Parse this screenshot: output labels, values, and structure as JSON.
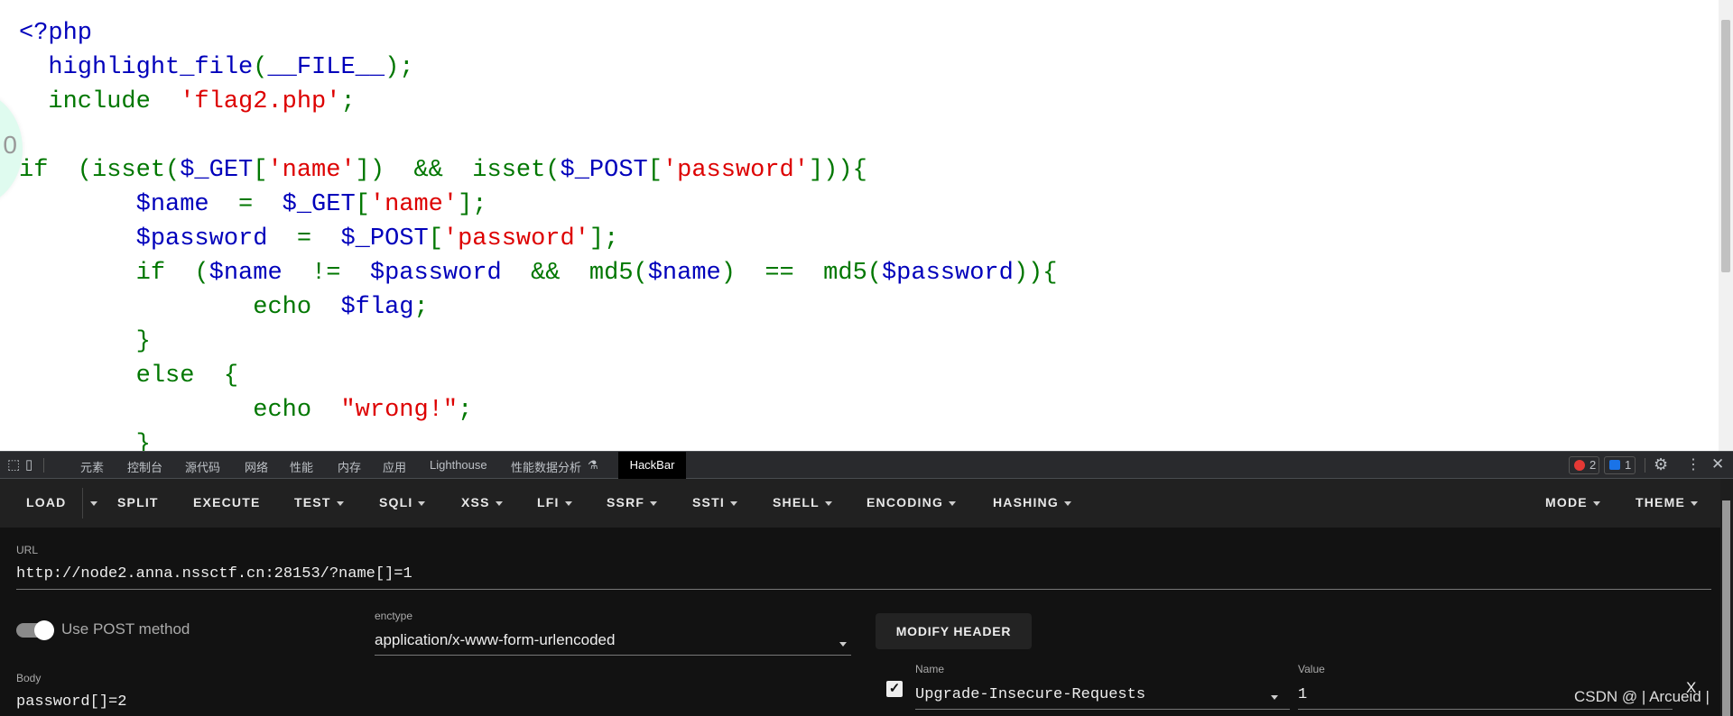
{
  "code": {
    "lines": [
      [
        {
          "t": "<?php",
          "c": "b"
        }
      ],
      [
        {
          "t": "  highlight_file",
          "c": "b"
        },
        {
          "t": "(",
          "c": "g"
        },
        {
          "t": "__FILE__",
          "c": "b"
        },
        {
          "t": ");",
          "c": "g"
        }
      ],
      [
        {
          "t": "  include  ",
          "c": "g"
        },
        {
          "t": "'flag2.php'",
          "c": "r"
        },
        {
          "t": ";",
          "c": "g"
        }
      ],
      [],
      [
        {
          "t": "if  (isset(",
          "c": "g"
        },
        {
          "t": "$_GET",
          "c": "b"
        },
        {
          "t": "[",
          "c": "g"
        },
        {
          "t": "'name'",
          "c": "r"
        },
        {
          "t": "])  &&  isset(",
          "c": "g"
        },
        {
          "t": "$_POST",
          "c": "b"
        },
        {
          "t": "[",
          "c": "g"
        },
        {
          "t": "'password'",
          "c": "r"
        },
        {
          "t": "])){",
          "c": "g"
        }
      ],
      [
        {
          "t": "        $name",
          "c": "b"
        },
        {
          "t": "  =  ",
          "c": "g"
        },
        {
          "t": "$_GET",
          "c": "b"
        },
        {
          "t": "[",
          "c": "g"
        },
        {
          "t": "'name'",
          "c": "r"
        },
        {
          "t": "];",
          "c": "g"
        }
      ],
      [
        {
          "t": "        $password",
          "c": "b"
        },
        {
          "t": "  =  ",
          "c": "g"
        },
        {
          "t": "$_POST",
          "c": "b"
        },
        {
          "t": "[",
          "c": "g"
        },
        {
          "t": "'password'",
          "c": "r"
        },
        {
          "t": "];",
          "c": "g"
        }
      ],
      [
        {
          "t": "        if  (",
          "c": "g"
        },
        {
          "t": "$name",
          "c": "b"
        },
        {
          "t": "  !=  ",
          "c": "g"
        },
        {
          "t": "$password",
          "c": "b"
        },
        {
          "t": "  &&  md5(",
          "c": "g"
        },
        {
          "t": "$name",
          "c": "b"
        },
        {
          "t": ")  ==  md5(",
          "c": "g"
        },
        {
          "t": "$password",
          "c": "b"
        },
        {
          "t": ")){",
          "c": "g"
        }
      ],
      [
        {
          "t": "                echo  ",
          "c": "g"
        },
        {
          "t": "$flag",
          "c": "b"
        },
        {
          "t": ";",
          "c": "g"
        }
      ],
      [
        {
          "t": "        }",
          "c": "g"
        }
      ],
      [
        {
          "t": "        else  {",
          "c": "g"
        }
      ],
      [
        {
          "t": "                echo  ",
          "c": "g"
        },
        {
          "t": "\"wrong!\"",
          "c": "r"
        },
        {
          "t": ";",
          "c": "g"
        }
      ],
      [
        {
          "t": "        }",
          "c": "g"
        }
      ]
    ]
  },
  "colors": {
    "default": "#0000BB",
    "keyword": "#007700",
    "string": "#DD0000"
  },
  "devtools": {
    "tabs": [
      "元素",
      "控制台",
      "源代码",
      "网络",
      "性能",
      "内存",
      "应用",
      "Lighthouse",
      "性能数据分析"
    ],
    "active_tab": "HackBar",
    "errors": "2",
    "messages": "1"
  },
  "hackbar": {
    "menu": [
      "LOAD",
      "SPLIT",
      "EXECUTE",
      "TEST",
      "SQLI",
      "XSS",
      "LFI",
      "SSRF",
      "SSTI",
      "SHELL",
      "ENCODING",
      "HASHING"
    ],
    "right_menu": [
      "MODE",
      "THEME"
    ],
    "url_label": "URL",
    "url": "http://node2.anna.nssctf.cn:28153/?name[]=1",
    "post_label": "Use POST method",
    "post_enabled": true,
    "enctype_label": "enctype",
    "enctype": "application/x-www-form-urlencoded",
    "modify_header": "MODIFY HEADER",
    "body_label": "Body",
    "body": "password[]=2",
    "header_name_label": "Name",
    "header_name": "Upgrade-Insecure-Requests",
    "header_value_label": "Value",
    "header_value": "1",
    "header_remove": "X"
  },
  "watermark": "CSDN @ | Arcueid |"
}
